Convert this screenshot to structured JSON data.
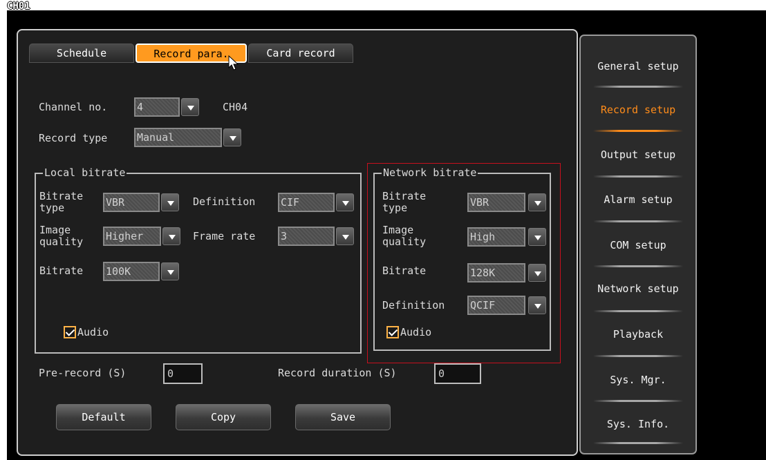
{
  "channel_title": "CH01",
  "tabs": [
    {
      "label": "Schedule",
      "active": false
    },
    {
      "label": "Record para.",
      "active": true
    },
    {
      "label": "Card record",
      "active": false
    }
  ],
  "channel": {
    "label": "Channel no.",
    "value": "4",
    "name": "CH04"
  },
  "record_type": {
    "label": "Record type",
    "value": "Manual"
  },
  "local_bitrate": {
    "title": "Local bitrate",
    "bitrate_type": {
      "label1": "Bitrate",
      "label2": "type",
      "value": "VBR"
    },
    "definition": {
      "label": "Definition",
      "value": "CIF"
    },
    "image_quality": {
      "label1": "Image",
      "label2": "quality",
      "value": "Higher"
    },
    "frame_rate": {
      "label": "Frame rate",
      "value": "3"
    },
    "bitrate": {
      "label": "Bitrate",
      "value": "100K"
    },
    "audio": {
      "label": "Audio",
      "checked": true
    }
  },
  "network_bitrate": {
    "title": "Network bitrate",
    "bitrate_type": {
      "label1": "Bitrate",
      "label2": "type",
      "value": "VBR"
    },
    "image_quality": {
      "label1": "Image",
      "label2": "quality",
      "value": "High"
    },
    "bitrate": {
      "label": "Bitrate",
      "value": "128K"
    },
    "definition": {
      "label": "Definition",
      "value": "QCIF"
    },
    "audio": {
      "label": "Audio",
      "checked": true
    }
  },
  "pre_record": {
    "label": "Pre-record (S)",
    "value": "0"
  },
  "record_duration": {
    "label": "Record duration (S)",
    "value": "0"
  },
  "buttons": {
    "default": "Default",
    "copy": "Copy",
    "save": "Save"
  },
  "menu": [
    {
      "label": "General setup",
      "active": false
    },
    {
      "label": "Record setup",
      "active": true
    },
    {
      "label": "Output setup",
      "active": false
    },
    {
      "label": "Alarm setup",
      "active": false
    },
    {
      "label": "COM setup",
      "active": false
    },
    {
      "label": "Network setup",
      "active": false
    },
    {
      "label": "Playback",
      "active": false
    },
    {
      "label": "Sys. Mgr.",
      "active": false
    },
    {
      "label": "Sys. Info.",
      "active": false
    }
  ],
  "colors": {
    "accent": "#ff9a1f",
    "highlight_outline": "#c8101e",
    "panel_bg": "#1e1e1e"
  }
}
